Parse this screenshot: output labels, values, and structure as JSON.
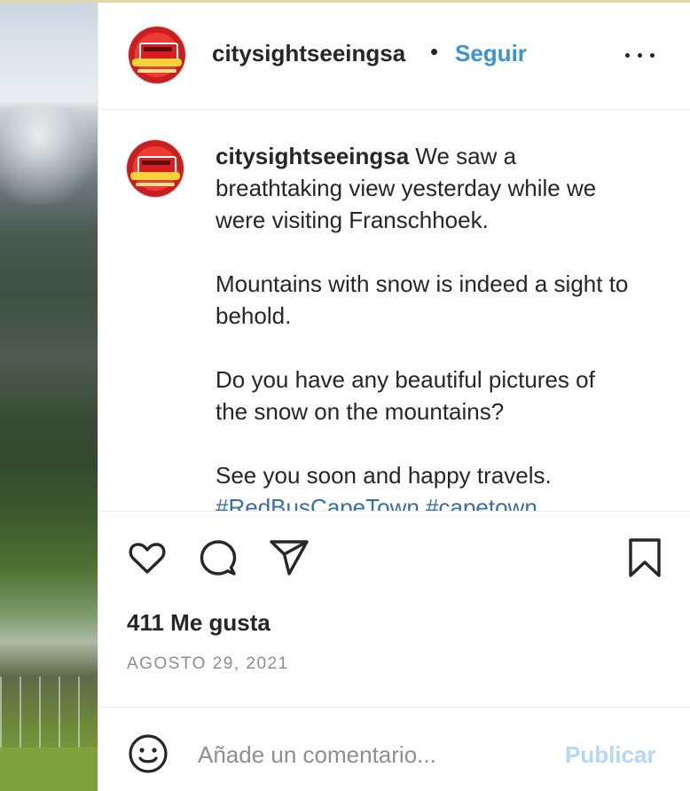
{
  "header": {
    "username": "citysightseeingsa",
    "separator": "•",
    "follow_label": "Seguir",
    "more_icon": "more-horizontal-icon"
  },
  "caption": {
    "username": "citysightseeingsa",
    "text": " We saw a breathtaking view yesterday while we were visiting Franschhoek.\n\nMountains with snow is indeed a sight to behold.\n\nDo you have any beautiful pictures of the snow on the mountains?\n\nSee you soon and happy travels.\n",
    "hashtags": "#RedBusCapeTown #capetown"
  },
  "actions": {
    "like_icon": "heart-icon",
    "comment_icon": "comment-icon",
    "share_icon": "send-icon",
    "save_icon": "bookmark-icon"
  },
  "likes_label": "411 Me gusta",
  "date_label": "AGOSTO 29, 2021",
  "comment_box": {
    "emoji_icon": "emoji-icon",
    "placeholder": "Añade un comentario...",
    "value": "",
    "publish_label": "Publicar"
  },
  "colors": {
    "accent": "#3b93d6",
    "publish_disabled": "#b3d8f5",
    "text": "#262626",
    "muted": "#8e8e8e"
  }
}
